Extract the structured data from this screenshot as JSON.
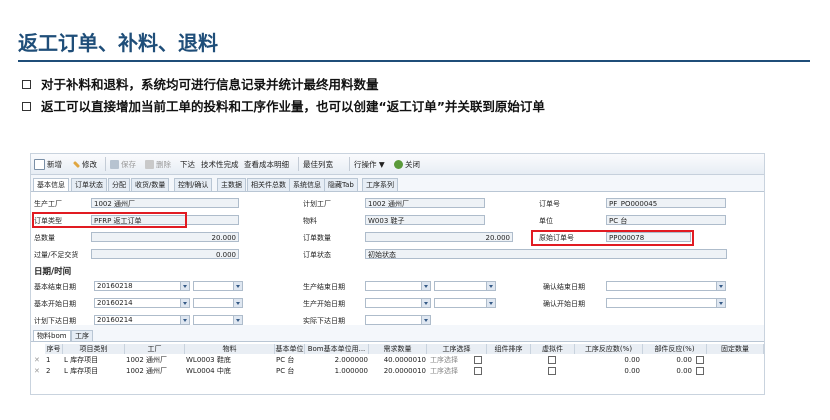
{
  "slide": {
    "title": "返工订单、补料、退料",
    "bullets": [
      "对于补料和退料，系统均可进行信息记录并统计最终用料数量",
      "返工可以直接增加当前工单的投料和工序作业量，也可以创建“返工订单”并关联到原始订单"
    ]
  },
  "toolbar": {
    "new": "新增",
    "edit": "修改",
    "save": "保存",
    "delete": "删除",
    "release": "下达",
    "tech_done": "技术性完成",
    "cost_report": "查看成本明细",
    "best_width": "最佳列宽",
    "actions": "行操作 ▼",
    "close": "关闭"
  },
  "tabs": [
    "基本信息",
    "订单状态",
    "分配",
    "收货/数量",
    "控制/确认",
    "主数据",
    "相关件总数",
    "系统信息",
    "隐藏Tab",
    "工序系列"
  ],
  "form": {
    "plant_label": "生产工厂",
    "plant_value": "1002 通州厂",
    "order_type_label": "订单类型",
    "order_type_value": "PFRP 返工订单",
    "total_qty_label": "总数量",
    "total_qty_value": "20.000",
    "scrap_label": "过量/不足交货",
    "scrap_value": "0.000",
    "plan_plant_label": "计划工厂",
    "plan_plant_value": "1002 通州厂",
    "material_label": "物料",
    "material_value": "W003 鞋子",
    "order_qty_label": "订单数量",
    "order_qty_value": "20.000",
    "order_status_label": "订单状态",
    "order_status_value": "初始状态",
    "order_no_label": "订单号",
    "order_no_value": "PF_PO000045",
    "unit_label": "单位",
    "unit_value": "PC 台",
    "orig_order_label": "原始订单号",
    "orig_order_value": "PP000078"
  },
  "dates": {
    "section": "日期/时间",
    "basic_end_label": "基本结束日期",
    "basic_end_value": "20160218",
    "basic_start_label": "基本开始日期",
    "basic_start_value": "20160214",
    "plan_release_label": "计划下达日期",
    "plan_release_value": "20160214",
    "prod_end_label": "生产结束日期",
    "prod_start_label": "生产开始日期",
    "actual_release_label": "实际下达日期",
    "confirm_end_label": "确认结束日期",
    "confirm_start_label": "确认开始日期"
  },
  "bottom_tabs": [
    "物料bom",
    "工序"
  ],
  "grid": {
    "headers": [
      "序号",
      "项目类别",
      "工厂",
      "物料",
      "基本单位",
      "Bom基本单位用...",
      "需求数量",
      "工序选择",
      "组件排序",
      "虚拟件",
      "工序反应数(%)",
      "部件反应(%)",
      "固定数量"
    ],
    "rows": [
      {
        "no": "1",
        "cat": "L 库存项目",
        "plant": "1002 通州厂",
        "material": "WL0003 鞋底",
        "unit": "PC 台",
        "bom_qty": "2.000000",
        "req_qty": "40.0000010",
        "op": "工序选择",
        "scrap1": "0.00",
        "scrap2": "0.00"
      },
      {
        "no": "2",
        "cat": "L 库存项目",
        "plant": "1002 通州厂",
        "material": "WL0004 中底",
        "unit": "PC 台",
        "bom_qty": "1.000000",
        "req_qty": "20.0000010",
        "op": "工序选择",
        "scrap1": "0.00",
        "scrap2": "0.00"
      }
    ]
  },
  "colors": {
    "title": "#1f4e79",
    "highlight": "#e11b22"
  }
}
